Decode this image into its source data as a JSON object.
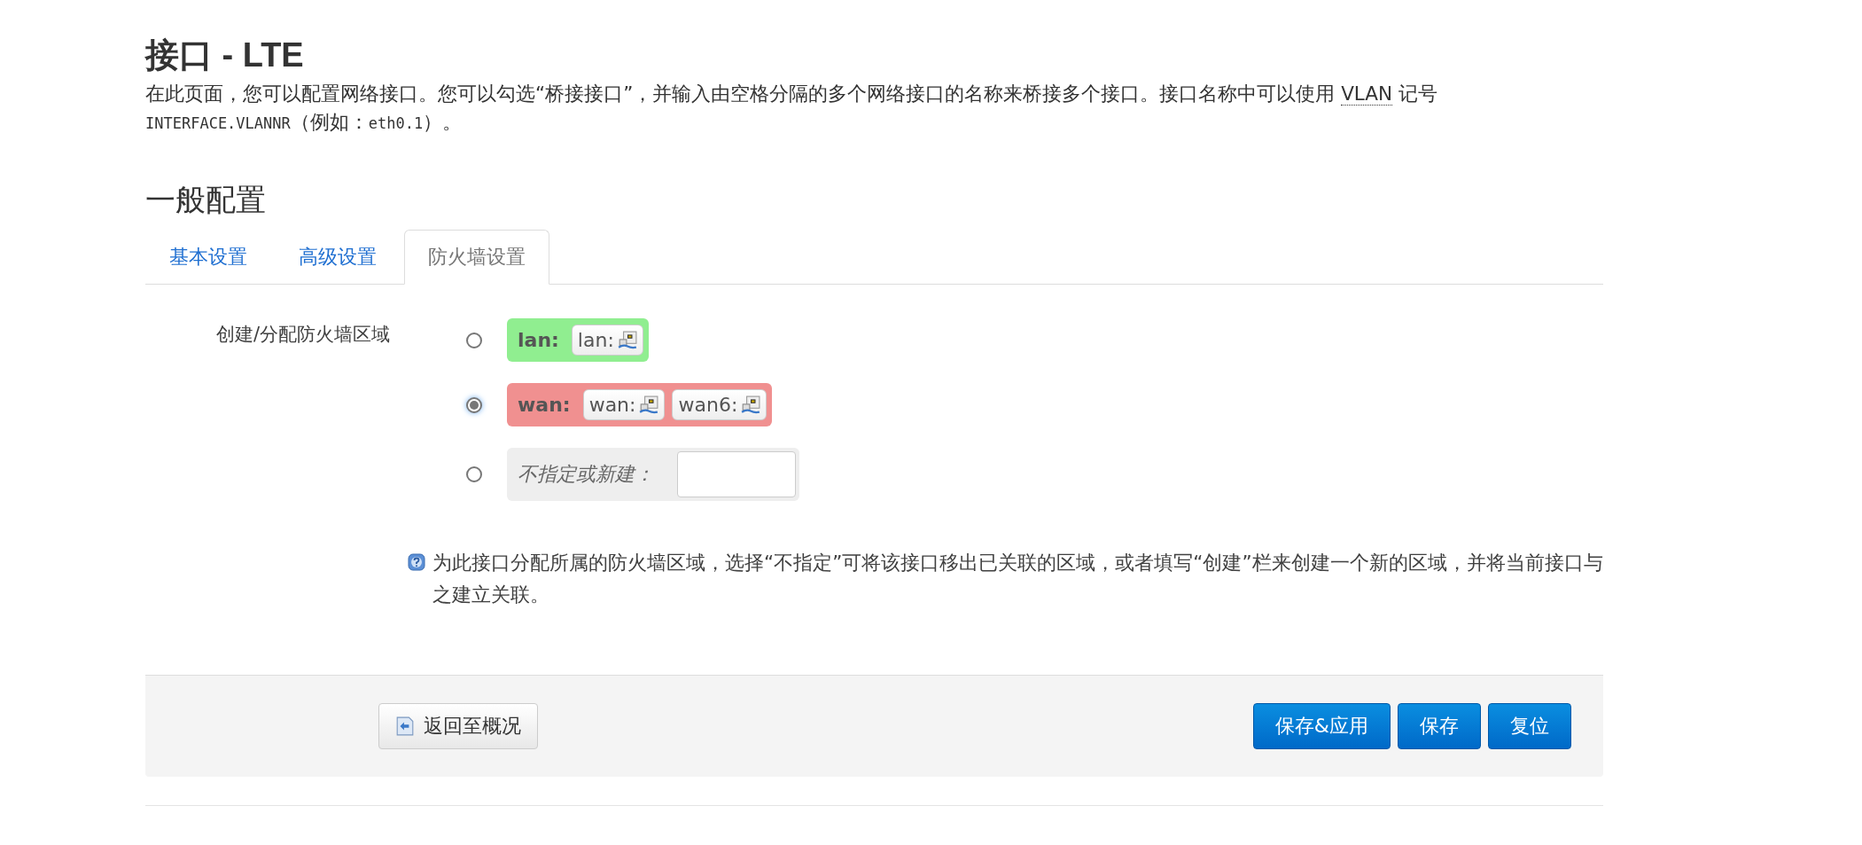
{
  "page": {
    "title": "接口 - LTE",
    "description": [
      [
        {
          "kind": "text",
          "text": "在此页面，您可以配置网络接口。您可以勾选“桥接接口”，并输入由空格分隔的多个网络接口的名称来桥接多个接口。接口名称中可以使用 "
        },
        {
          "kind": "abbr",
          "text": "VLAN"
        },
        {
          "kind": "text",
          "text": " 记号"
        }
      ],
      [
        {
          "kind": "code",
          "text": "INTERFACE.VLANNR"
        },
        {
          "kind": "text",
          "text": "（例如："
        },
        {
          "kind": "code",
          "text": "eth0.1"
        },
        {
          "kind": "text",
          "text": "）。"
        }
      ]
    ]
  },
  "section": {
    "title": "一般配置",
    "tabs": [
      {
        "label": "基本设置",
        "selected": false
      },
      {
        "label": "高级设置",
        "selected": false
      },
      {
        "label": "防火墙设置",
        "selected": true
      }
    ],
    "field": {
      "label": "创建/分配防火墙区域",
      "options": [
        {
          "kind": "zone",
          "name": "lan:",
          "color": "#90ee90",
          "selected": false,
          "networks": [
            "lan:"
          ]
        },
        {
          "kind": "zone",
          "name": "wan:",
          "color": "#f09090",
          "selected": true,
          "networks": [
            "wan:",
            "wan6:"
          ]
        },
        {
          "kind": "custom",
          "name": "不指定或新建：",
          "selected": false
        }
      ],
      "help": "为此接口分配所属的防火墙区域，选择“不指定”可将该接口移出已关联的区域，或者填写“创建”栏来创建一个新的区域，并将当前接口与之建立关联。"
    }
  },
  "actions": {
    "back": "返回至概况",
    "buttons": [
      "保存&应用",
      "保存",
      "复位"
    ]
  }
}
